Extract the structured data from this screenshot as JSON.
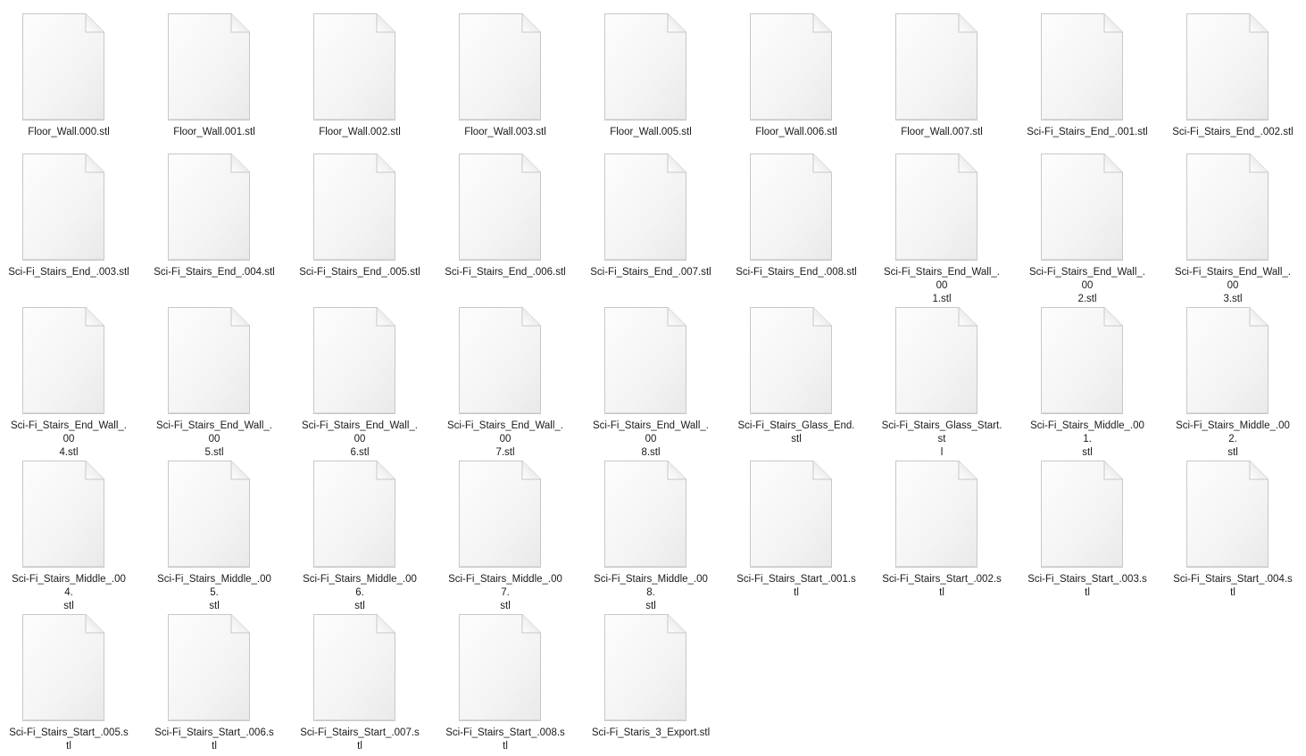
{
  "files": [
    {
      "name": "Floor_Wall.000.stl",
      "line2": ""
    },
    {
      "name": "Floor_Wall.001.stl",
      "line2": ""
    },
    {
      "name": "Floor_Wall.002.stl",
      "line2": ""
    },
    {
      "name": "Floor_Wall.003.stl",
      "line2": ""
    },
    {
      "name": "Floor_Wall.005.stl",
      "line2": ""
    },
    {
      "name": "Floor_Wall.006.stl",
      "line2": ""
    },
    {
      "name": "Floor_Wall.007.stl",
      "line2": ""
    },
    {
      "name": "Sci-Fi_Stairs_End_.001.stl",
      "line2": ""
    },
    {
      "name": "Sci-Fi_Stairs_End_.002.stl",
      "line2": ""
    },
    {
      "name": "Sci-Fi_Stairs_End_.003.stl",
      "line2": ""
    },
    {
      "name": "Sci-Fi_Stairs_End_.004.stl",
      "line2": ""
    },
    {
      "name": "Sci-Fi_Stairs_End_.005.stl",
      "line2": ""
    },
    {
      "name": "Sci-Fi_Stairs_End_.006.stl",
      "line2": ""
    },
    {
      "name": "Sci-Fi_Stairs_End_.007.stl",
      "line2": ""
    },
    {
      "name": "Sci-Fi_Stairs_End_.008.stl",
      "line2": ""
    },
    {
      "name": "Sci-Fi_Stairs_End_Wall_.00",
      "line2": "1.stl"
    },
    {
      "name": "Sci-Fi_Stairs_End_Wall_.00",
      "line2": "2.stl"
    },
    {
      "name": "Sci-Fi_Stairs_End_Wall_.00",
      "line2": "3.stl"
    },
    {
      "name": "Sci-Fi_Stairs_End_Wall_.00",
      "line2": "4.stl"
    },
    {
      "name": "Sci-Fi_Stairs_End_Wall_.00",
      "line2": "5.stl"
    },
    {
      "name": "Sci-Fi_Stairs_End_Wall_.00",
      "line2": "6.stl"
    },
    {
      "name": "Sci-Fi_Stairs_End_Wall_.00",
      "line2": "7.stl"
    },
    {
      "name": "Sci-Fi_Stairs_End_Wall_.00",
      "line2": "8.stl"
    },
    {
      "name": "Sci-Fi_Stairs_Glass_End.stl",
      "line2": ""
    },
    {
      "name": "Sci-Fi_Stairs_Glass_Start.st",
      "line2": "l"
    },
    {
      "name": "Sci-Fi_Stairs_Middle_.001.",
      "line2": "stl"
    },
    {
      "name": "Sci-Fi_Stairs_Middle_.002.",
      "line2": "stl"
    },
    {
      "name": "Sci-Fi_Stairs_Middle_.004.",
      "line2": "stl"
    },
    {
      "name": "Sci-Fi_Stairs_Middle_.005.",
      "line2": "stl"
    },
    {
      "name": "Sci-Fi_Stairs_Middle_.006.",
      "line2": "stl"
    },
    {
      "name": "Sci-Fi_Stairs_Middle_.007.",
      "line2": "stl"
    },
    {
      "name": "Sci-Fi_Stairs_Middle_.008.",
      "line2": "stl"
    },
    {
      "name": "Sci-Fi_Stairs_Start_.001.stl",
      "line2": ""
    },
    {
      "name": "Sci-Fi_Stairs_Start_.002.stl",
      "line2": ""
    },
    {
      "name": "Sci-Fi_Stairs_Start_.003.stl",
      "line2": ""
    },
    {
      "name": "Sci-Fi_Stairs_Start_.004.stl",
      "line2": ""
    },
    {
      "name": "Sci-Fi_Stairs_Start_.005.stl",
      "line2": ""
    },
    {
      "name": "Sci-Fi_Stairs_Start_.006.stl",
      "line2": ""
    },
    {
      "name": "Sci-Fi_Stairs_Start_.007.stl",
      "line2": ""
    },
    {
      "name": "Sci-Fi_Stairs_Start_.008.stl",
      "line2": ""
    },
    {
      "name": "Sci-Fi_Staris_3_Export.stl",
      "line2": ""
    }
  ],
  "icon": "blank-document-icon"
}
